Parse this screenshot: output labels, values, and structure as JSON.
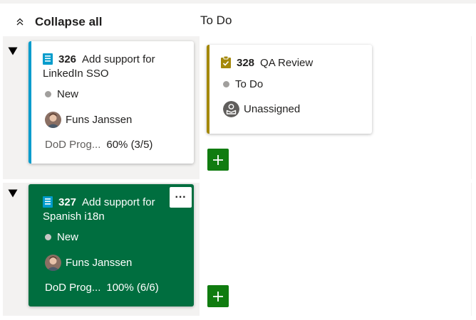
{
  "header": {
    "collapse_all_label": "Collapse all",
    "column_title": "To Do"
  },
  "lanes": [
    {
      "parent": {
        "id": "326",
        "title": "Add support for LinkedIn SSO",
        "state": "New",
        "assignee": "Funs Janssen",
        "field_name": "DoD Prog...",
        "field_value": "60% (3/5)"
      },
      "tasks": [
        {
          "id": "328",
          "title": "QA Review",
          "state": "To Do",
          "assignee": "Unassigned"
        }
      ]
    },
    {
      "parent": {
        "id": "327",
        "title": "Add support for Spanish i18n",
        "state": "New",
        "assignee": "Funs Janssen",
        "field_name": "DoD Prog...",
        "field_value": "100% (6/6)",
        "more_label": "···"
      },
      "tasks": []
    }
  ],
  "colors": {
    "story_bar": "#009ccc",
    "task_bar": "#a4880a",
    "selected_card": "#006e3f",
    "add_button": "#107c10",
    "lane_background": "#f3f2f1",
    "state_dot": "#a19f9d"
  },
  "icons": {
    "collapse": "double-chevron-up-icon",
    "expander": "triangle-down-icon",
    "story": "backlog-item-icon",
    "task": "clipboard-check-icon",
    "unassigned": "unassigned-avatar-icon",
    "add": "plus-icon",
    "more": "ellipsis-icon"
  }
}
